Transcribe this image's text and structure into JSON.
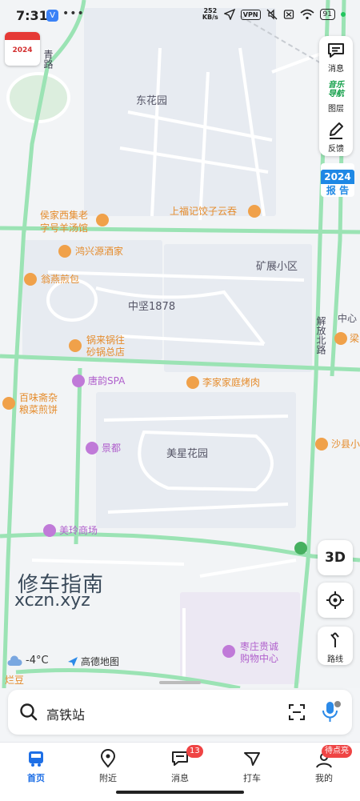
{
  "status_bar": {
    "time": "7:31",
    "app_badge": "V",
    "net_speed_value": "252",
    "net_speed_unit": "KB/s",
    "vpn": "VPN",
    "battery": "91"
  },
  "calendar": {
    "year": "2024"
  },
  "right_panel": {
    "messages_label": "消息",
    "layers_art_line1": "音乐",
    "layers_art_line2": "导航",
    "layers_label": "图层",
    "feedback_label": "反馈"
  },
  "report_badge": {
    "year": "2024",
    "text": "报 告"
  },
  "map": {
    "roads": [
      "青路",
      "解放北路"
    ],
    "areas": [
      "东花园",
      "矿展小区",
      "中坚1878",
      "美星花园"
    ],
    "pois": [
      {
        "label_line1": "侯家西集老",
        "label_line2": "字号羊汤馆",
        "category": "food"
      },
      {
        "label": "上福记饺子云吞",
        "category": "food"
      },
      {
        "label": "鸿兴源酒家",
        "category": "food"
      },
      {
        "label": "翁燕煎包",
        "category": "food"
      },
      {
        "label_line1": "锅来锅往",
        "label_line2": "砂锅总店",
        "category": "food"
      },
      {
        "label": "唐韵SPA",
        "category": "spa"
      },
      {
        "label": "李家家庭烤肉",
        "category": "food"
      },
      {
        "label_line1": "百味斋杂",
        "label_line2": "粮菜煎饼",
        "category": "food"
      },
      {
        "label": "景都",
        "category": "spa"
      },
      {
        "label": "美玲商场",
        "category": "shop"
      },
      {
        "label": "沙县小",
        "category": "food"
      },
      {
        "label": "中心",
        "category": "area"
      },
      {
        "label": "梁",
        "category": "food"
      },
      {
        "label_line1": "枣庄贵诚",
        "label_line2": "购物中心",
        "category": "shop"
      },
      {
        "label": "烂豆",
        "category": "food"
      }
    ]
  },
  "buttons": {
    "three_d": "3D",
    "route_label": "路线"
  },
  "watermark": {
    "line1": "修车指南",
    "line2": "xczn.xyz"
  },
  "weather": {
    "temperature": "-4°C"
  },
  "brand": {
    "name": "高德地图"
  },
  "search": {
    "query": "高铁站"
  },
  "bottom_nav": {
    "items": [
      {
        "label": "首页",
        "active": true
      },
      {
        "label": "附近"
      },
      {
        "label": "消息",
        "badge": "13"
      },
      {
        "label": "打车"
      },
      {
        "label": "我的",
        "badge": "待点亮"
      }
    ]
  },
  "colors": {
    "road_green": "#9be3b4",
    "poi_orange": "#f0a14a",
    "poi_purple": "#c07ad8",
    "accent_blue": "#1e6fe6",
    "badge_red": "#ef4444"
  }
}
